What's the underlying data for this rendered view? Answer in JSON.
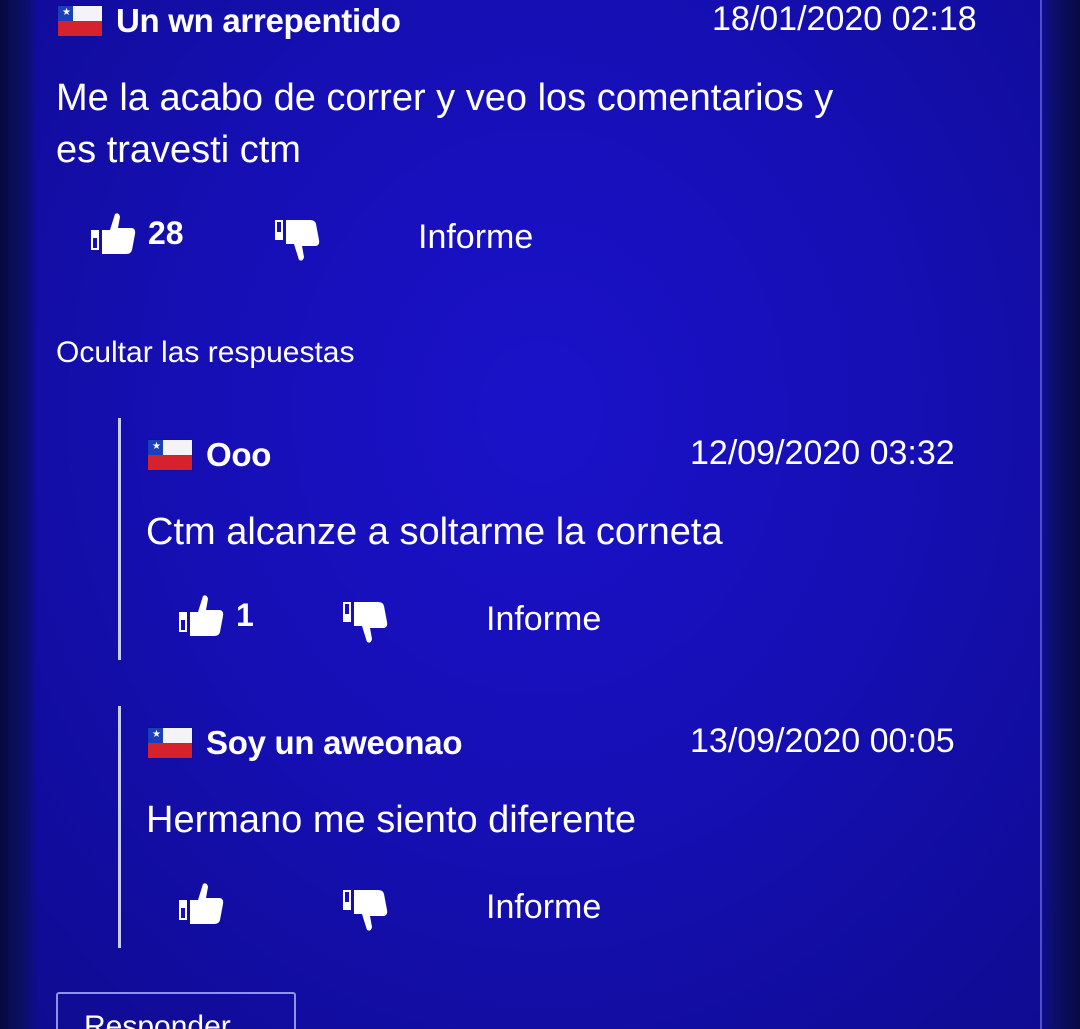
{
  "comment": {
    "username": "Un wn arrepentido",
    "timestamp": "18/01/2020 02:18",
    "text": [
      "Me la acabo de correr y veo los comentarios y",
      "es travesti ctm"
    ],
    "likes": "28",
    "report_label": "Informe",
    "country_flag": "chile-flag-icon"
  },
  "hide_replies_label": "Ocultar las respuestas",
  "replies": [
    {
      "username": "Ooo",
      "timestamp": "12/09/2020 03:32",
      "text": "Ctm alcanze a soltarme la corneta",
      "likes": "1",
      "report_label": "Informe"
    },
    {
      "username": "Soy un aweonao",
      "timestamp": "13/09/2020 00:05",
      "text": "Hermano me siento diferente",
      "likes": "",
      "report_label": "Informe"
    }
  ],
  "respond_label": "Responder",
  "colors": {
    "background": "#160fb5",
    "text": "#ffffff",
    "flag_red": "#d5222c",
    "flag_blue": "#1b3fb8"
  }
}
